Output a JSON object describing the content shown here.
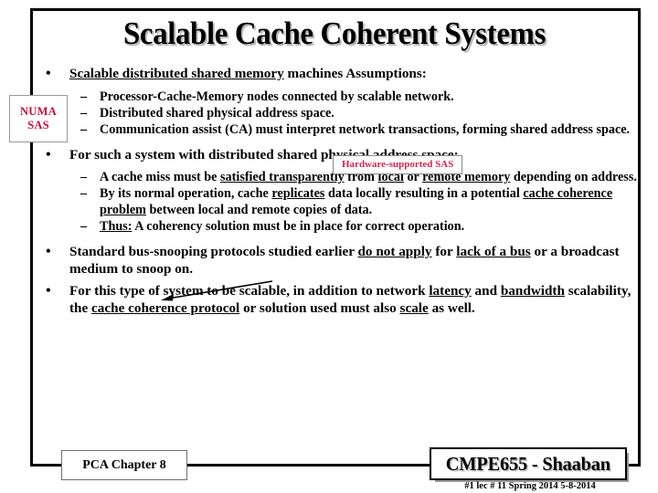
{
  "slide": {
    "title": "Scalable Cache Coherent Systems",
    "bullets": [
      {
        "level": 1,
        "parts": [
          {
            "text": "Scalable distributed shared memory",
            "underline": true
          },
          {
            "text": " machines Assumptions:",
            "underline": false
          }
        ]
      },
      {
        "level": 2,
        "parts": [
          {
            "text": "Processor-Cache-Memory nodes connected by scalable network.",
            "underline": false
          }
        ]
      },
      {
        "level": 2,
        "parts": [
          {
            "text": "Distributed shared physical address space.",
            "underline": false
          }
        ]
      },
      {
        "level": 2,
        "parts": [
          {
            "text": "Communication assist (CA) must interpret network transactions, forming shared address space.",
            "underline": false
          }
        ]
      },
      {
        "level": 1,
        "parts": [
          {
            "text": "For such a system with distributed shared physical address space:",
            "underline": false
          }
        ]
      },
      {
        "level": 2,
        "parts": [
          {
            "text": "A cache miss must be ",
            "underline": false
          },
          {
            "text": "satisfied transparently",
            "underline": true
          },
          {
            "text": " from ",
            "underline": false
          },
          {
            "text": "local",
            "underline": true
          },
          {
            "text": " or ",
            "underline": false
          },
          {
            "text": "remote memory",
            "underline": true
          },
          {
            "text": " depending on address.",
            "underline": false
          }
        ]
      },
      {
        "level": 2,
        "parts": [
          {
            "text": "By its normal operation, cache ",
            "underline": false
          },
          {
            "text": "replicates",
            "underline": true
          },
          {
            "text": " data locally resulting in a potential ",
            "underline": false
          },
          {
            "text": "cache coherence problem",
            "underline": true
          },
          {
            "text": " between local and remote copies of data.",
            "underline": false
          }
        ]
      },
      {
        "level": 2,
        "parts": [
          {
            "text": "Thus:",
            "underline": true
          },
          {
            "text": " A coherency solution must be in place for correct operation.",
            "underline": false
          }
        ]
      },
      {
        "level": 1,
        "parts": [
          {
            "text": "Standard bus-snooping protocols studied earlier ",
            "underline": false
          },
          {
            "text": "do not apply",
            "underline": true
          },
          {
            "text": " for ",
            "underline": false
          },
          {
            "text": "lack of a bus",
            "underline": true
          },
          {
            "text": " or a broadcast medium to snoop on.",
            "underline": false
          }
        ]
      },
      {
        "level": 1,
        "parts": [
          {
            "text": "For this type of system to be scalable, in addition to network ",
            "underline": false
          },
          {
            "text": "latency",
            "underline": true
          },
          {
            "text": " and ",
            "underline": false
          },
          {
            "text": "bandwidth",
            "underline": true
          },
          {
            "text": " scalability, the ",
            "underline": false
          },
          {
            "text": "cache coherence protocol",
            "underline": true
          },
          {
            "text": " or solution used must also ",
            "underline": false
          },
          {
            "text": "scale",
            "underline": true
          },
          {
            "text": " as well.",
            "underline": false
          }
        ]
      }
    ],
    "bullet_glyph": "•",
    "dash_glyph": "–"
  },
  "callouts": {
    "numa": {
      "line1": "NUMA",
      "line2": "SAS",
      "color": "#c8103c"
    },
    "hardware_sas": {
      "label": "Hardware-supported SAS",
      "color": "#d4234c"
    }
  },
  "footer": {
    "chapter_label": "PCA Chapter 8",
    "course_label": "CMPE655 - Shaaban",
    "stamp": "#1   lec # 11   Spring 2014   5-8-2014"
  }
}
